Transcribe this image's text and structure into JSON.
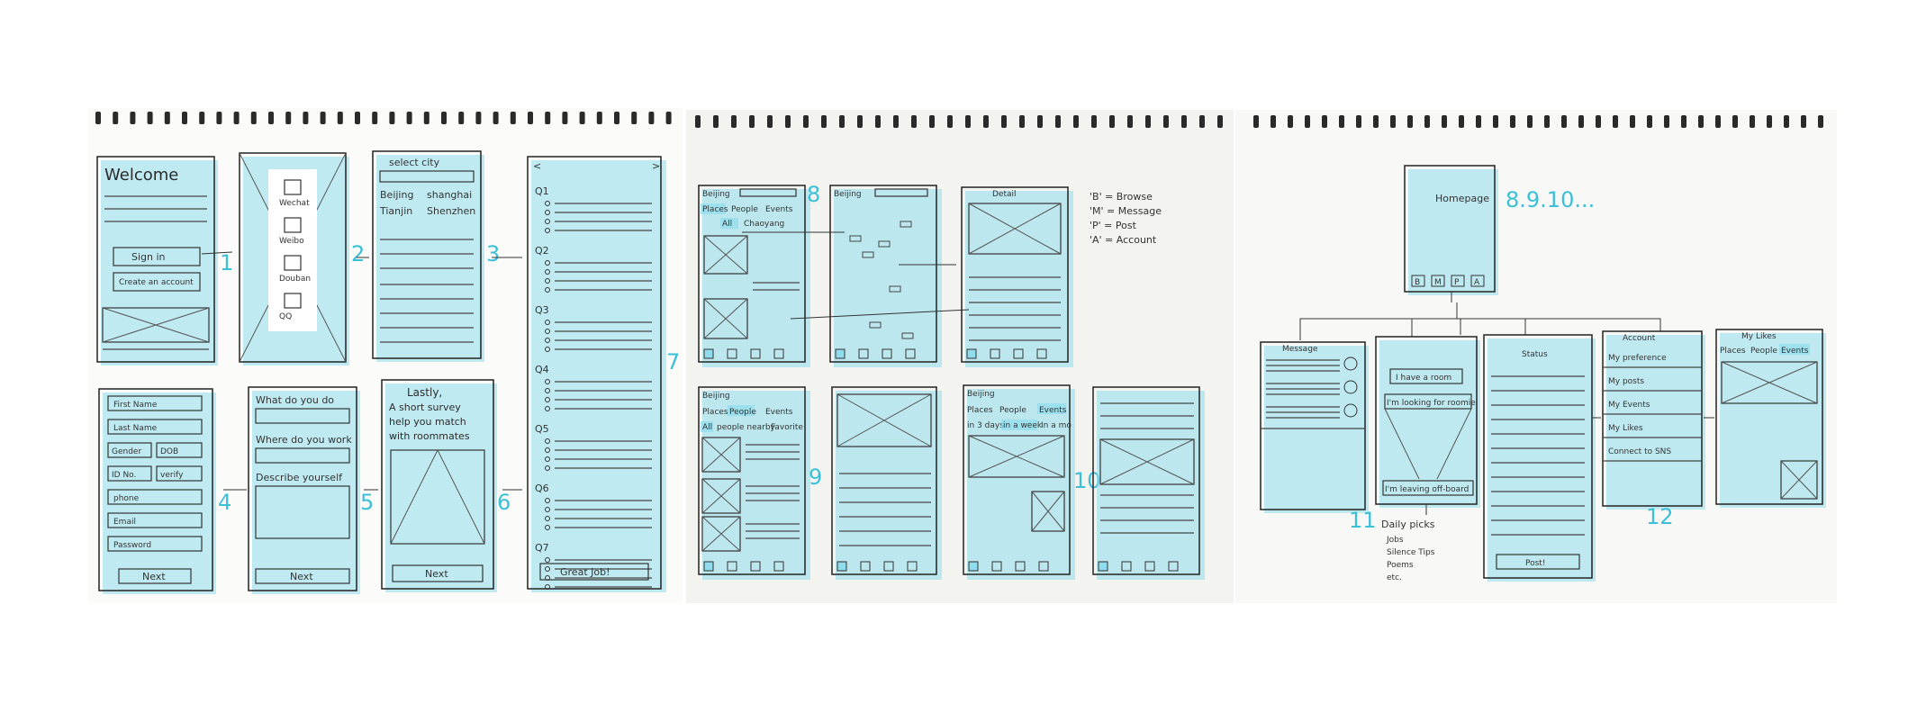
{
  "sheet1": {
    "welcome": {
      "title": "Welcome",
      "sign_in": "Sign in",
      "create": "Create an account",
      "num": "1"
    },
    "social": {
      "items": [
        "Wechat",
        "Weibo",
        "Douban",
        "QQ"
      ],
      "num": "2"
    },
    "city": {
      "title": "select city",
      "cities": [
        "Beijing",
        "shanghai",
        "Tianjin",
        "Shenzhen"
      ],
      "num": "3"
    },
    "survey": {
      "questions": [
        "Q1",
        "Q2",
        "Q3",
        "Q4",
        "Q5",
        "Q6",
        "Q7"
      ],
      "button": "Great Job!",
      "num": "7"
    },
    "profile": {
      "fields": [
        "First Name",
        "Last Name",
        "Gender",
        "DOB",
        "ID No.",
        "verify",
        "phone",
        "Email",
        "Password"
      ],
      "button": "Next",
      "num": "4"
    },
    "work": {
      "q1": "What do you do",
      "q2": "Where do you work",
      "q3": "Describe yourself",
      "button": "Next",
      "num": "5"
    },
    "lastly": {
      "text": [
        "Lastly,",
        "A short survey",
        "help you match",
        "with roommates"
      ],
      "button": "Next",
      "num": "6"
    }
  },
  "sheet2": {
    "legend": [
      "'B' = Browse",
      "'M' = Message",
      "'P' = Post",
      "'A' = Account"
    ],
    "browse1": {
      "city": "Beijing",
      "tabs": [
        "Places",
        "People",
        "Events"
      ],
      "filters": [
        "All",
        "Chaoyang"
      ],
      "num": "8"
    },
    "map": {
      "city": "Beijing"
    },
    "detail": {
      "title": "Detail"
    },
    "people": {
      "city": "Beijing",
      "tabs": [
        "Places",
        "People",
        "Events"
      ],
      "filters": [
        "All",
        "people nearby",
        "Favorite"
      ],
      "num": "9"
    },
    "events": {
      "city": "Beijing",
      "tabs": [
        "Places",
        "People",
        "Events"
      ],
      "filters": [
        "in 3 days",
        "in a week",
        "In a mo"
      ],
      "num": "10"
    },
    "tabbar": [
      "B",
      "M",
      "P",
      "A"
    ]
  },
  "sheet3": {
    "homepage": {
      "title": "Homepage",
      "num": "8.9.10...",
      "tabs": [
        "B",
        "M",
        "P",
        "A"
      ]
    },
    "message": {
      "title": "Message",
      "num": "11"
    },
    "post": {
      "options": [
        "I have a room",
        "I'm looking for roomie",
        "I'm leaving off-board"
      ]
    },
    "daily": {
      "title": "Daily picks",
      "items": [
        "Jobs",
        "Silence Tips",
        "Poems",
        "etc."
      ]
    },
    "status": {
      "title": "Status",
      "button": "Post!"
    },
    "account": {
      "title": "Account",
      "items": [
        "My preference",
        "My posts",
        "My Events",
        "My Likes",
        "Connect to SNS"
      ],
      "num": "12"
    },
    "likes": {
      "title": "My Likes",
      "tabs": [
        "Places",
        "People",
        "Events"
      ]
    }
  }
}
